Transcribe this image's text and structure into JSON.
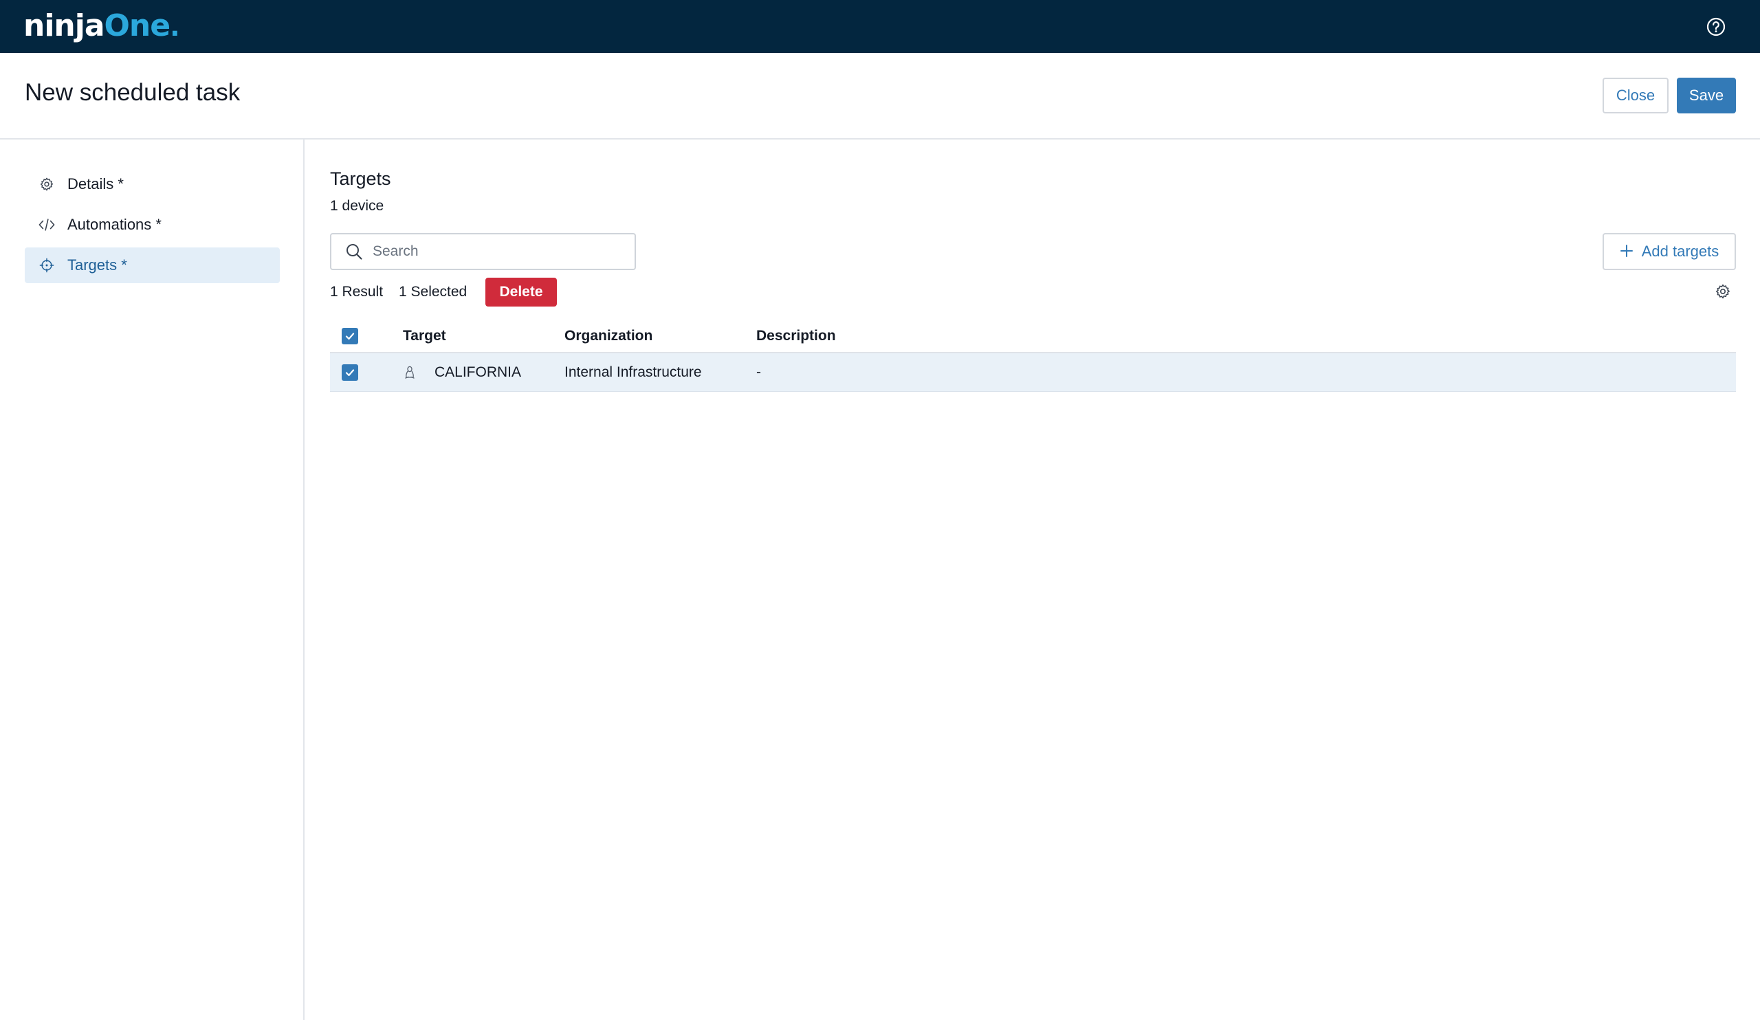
{
  "topbar": {
    "logo_ninja": "ninja",
    "logo_one": "One",
    "logo_dot": ".",
    "brand_color": "#03263f",
    "accent_color": "#2ba8dc",
    "help_icon": "question-circle-icon"
  },
  "header": {
    "title": "New scheduled task",
    "close_label": "Close",
    "save_label": "Save"
  },
  "sidebar": {
    "items": [
      {
        "label": "Details *",
        "icon": "gear-icon",
        "active": false
      },
      {
        "label": "Automations *",
        "icon": "code-icon",
        "active": false
      },
      {
        "label": "Targets *",
        "icon": "crosshair-icon",
        "active": true
      }
    ]
  },
  "main": {
    "title": "Targets",
    "subtitle": "1 device",
    "search_placeholder": "Search",
    "search_value": "",
    "add_targets_label": "Add targets",
    "result_count": "1 Result",
    "selected_count": "1 Selected",
    "delete_label": "Delete",
    "settings_icon": "gear-icon"
  },
  "table": {
    "columns": [
      "Target",
      "Organization",
      "Description"
    ],
    "select_all_checked": true,
    "rows": [
      {
        "checked": true,
        "os_icon": "linux-icon",
        "target": "CALIFORNIA",
        "organization": "Internal Infrastructure",
        "description": "-"
      }
    ]
  },
  "colors": {
    "primary": "#337ab7",
    "danger": "#d02b3b",
    "selected_row": "#e9f1f8",
    "active_nav": "#e3eef8"
  }
}
